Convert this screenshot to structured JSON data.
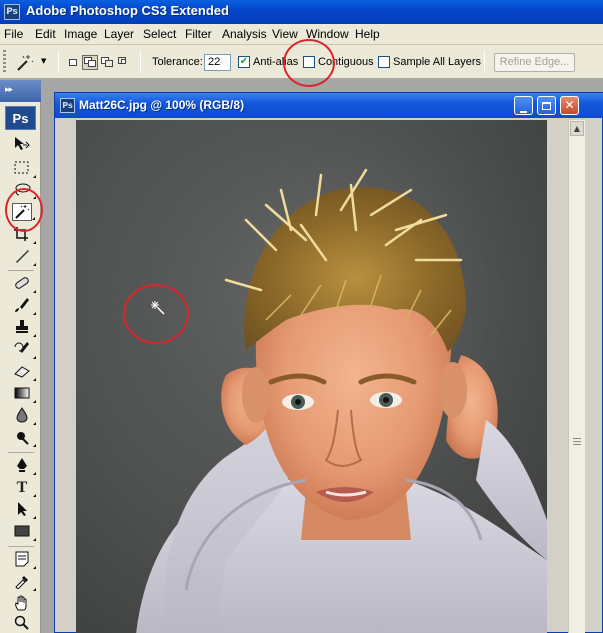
{
  "window": {
    "title": "Adobe Photoshop CS3 Extended",
    "app_badge": "Ps"
  },
  "menu": [
    "File",
    "Edit",
    "Image",
    "Layer",
    "Select",
    "Filter",
    "Analysis",
    "View",
    "Window",
    "Help"
  ],
  "options": {
    "tolerance_label": "Tolerance:",
    "tolerance_value": "22",
    "anti_alias_label": "Anti-alias",
    "anti_alias_checked": true,
    "contiguous_label": "Contiguous",
    "contiguous_checked": false,
    "sample_all_label": "Sample All Layers",
    "sample_all_checked": false,
    "refine_edge_label": "Refine Edge..."
  },
  "tools_panel": {
    "logo": "Ps",
    "active_tool": "magic-wand"
  },
  "document": {
    "title": "Matt26C.jpg @ 100% (RGB/8)",
    "badge": "Ps"
  },
  "colors": {
    "annotation_ring": "#d8262a",
    "titlebar_blue": "#0545c8",
    "panel_bg": "#ece9d8"
  }
}
